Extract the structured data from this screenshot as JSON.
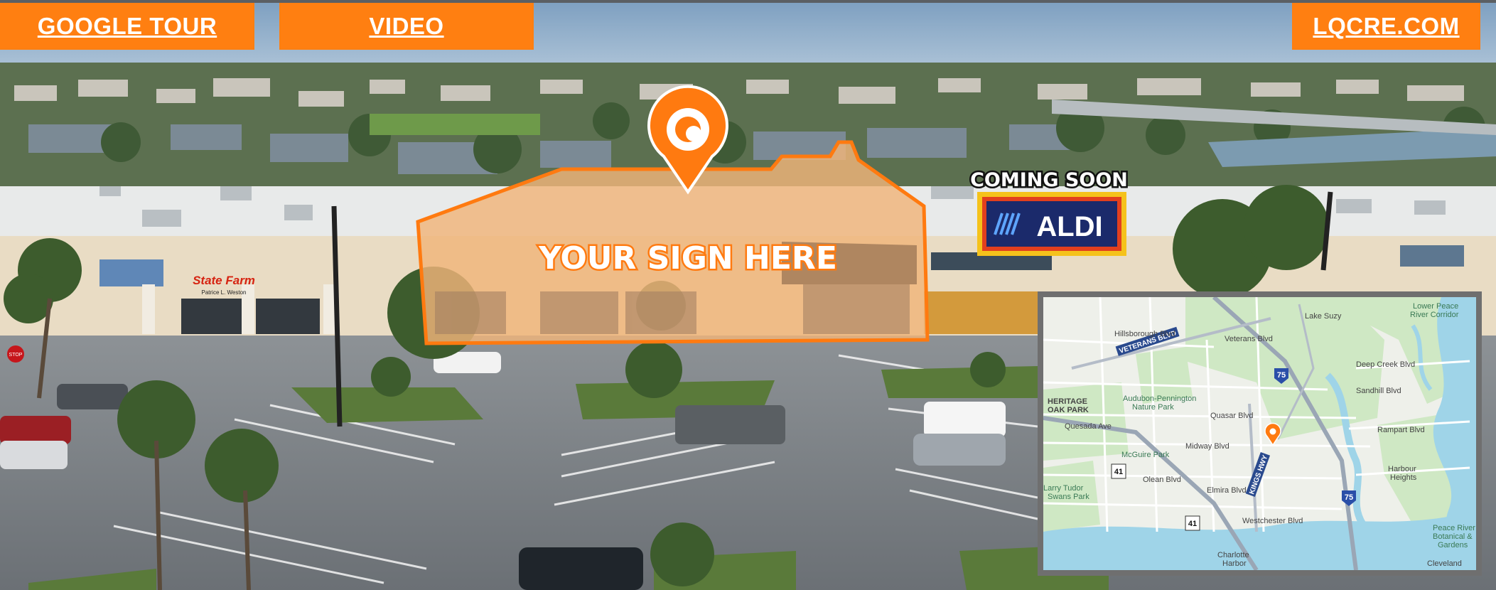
{
  "nav": {
    "google_tour": "GOOGLE TOUR",
    "video": "VIDEO",
    "website": "LQCRE.COM"
  },
  "signage": {
    "headline": "YOUR SIGN HERE"
  },
  "anchor": {
    "coming_soon": "COMING SOON",
    "brand": "ALDI"
  },
  "tenant_signs": {
    "statefarm": "State Farm",
    "statefarm_agent": "Patrice L. Weston",
    "stop": "STOP"
  },
  "colors": {
    "accent": "#ff7f11",
    "aldi_navy": "#1b2a6b",
    "aldi_frame": "#f5c21b"
  },
  "map": {
    "labels": {
      "lake_suzy": "Lake Suzy",
      "lower_peace": "Lower Peace",
      "river_corridor": "River Corridor",
      "veterans_blvd": "VETERANS BLVD",
      "heritage": "HERITAGE",
      "oak_park": "OAK PARK",
      "audubon": "Audubon-Pennington",
      "nature_park": "Nature Park",
      "quesada": "Quesada Ave",
      "mcguire": "McGuire Park",
      "kings_hwy": "KINGS HWY",
      "larry_tudor": "Larry Tudor",
      "swans_park": "Swans Park",
      "harbour_heights": "Harbour",
      "harbour_heights2": "Heights",
      "charlotte_harbor": "Charlotte",
      "charlotte_harbor2": "Harbor",
      "peace_river": "Peace River",
      "botanical": "Botanical &",
      "gardens": "Gardens",
      "cleveland": "Cleveland",
      "deep_creek": "Deep Creek Blvd",
      "sandhill": "Sandhill Blvd",
      "rampart": "Rampart Blvd",
      "midway": "Midway Blvd",
      "olean": "Olean Blvd",
      "elmira": "Elmira Blvd",
      "westchester": "Westchester Blvd",
      "hillsborough": "Hillsborough Blvd",
      "veterans2": "Veterans Blvd",
      "quasar": "Quasar Blvd"
    },
    "shields": {
      "i75_a": "75",
      "i75_b": "75",
      "us41_a": "41",
      "us41_b": "41"
    },
    "icons": {
      "pin": "location-pin-icon"
    }
  }
}
